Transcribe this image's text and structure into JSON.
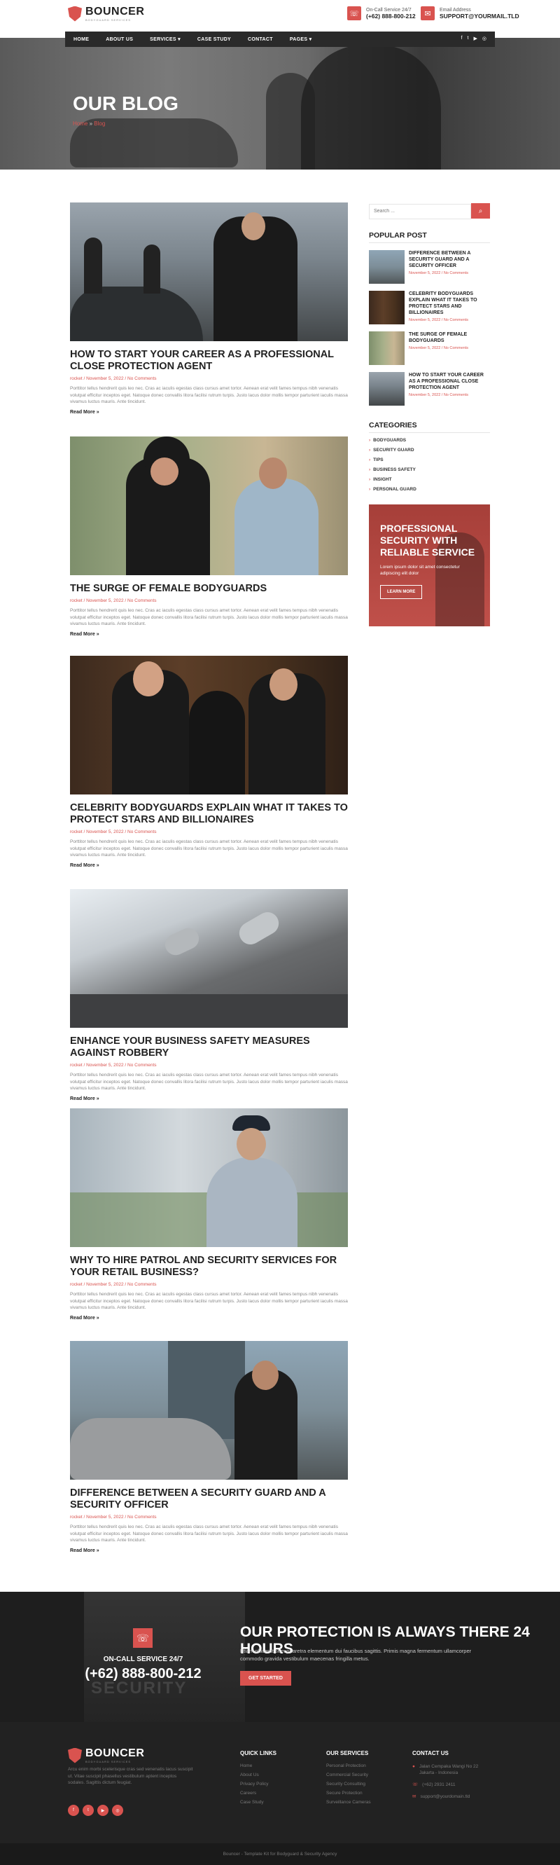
{
  "brand": {
    "name": "BOUNCER",
    "tagline": "BODYGUARD SERVICES"
  },
  "topbar": {
    "call_label": "On-Call Service 24/7",
    "call_value": "(+62) 888-800-212",
    "email_label": "Email Address",
    "email_value": "SUPPORT@YOURMAIL.TLD"
  },
  "nav": {
    "items": [
      "HOME",
      "ABOUT US",
      "SERVICES ▾",
      "CASE STUDY",
      "CONTACT",
      "PAGES ▾"
    ],
    "social": [
      "f",
      "t",
      "▶",
      "◎"
    ]
  },
  "hero": {
    "title": "OUR BLOG",
    "crumb_home": "Home",
    "crumb_sep": "»",
    "crumb_current": "Blog"
  },
  "posts": [
    {
      "title": "HOW TO START YOUR CAREER AS A PROFESSIONAL CLOSE PROTECTION AGENT",
      "meta": "rocket / November 5, 2022 / No Comments"
    },
    {
      "title": "THE SURGE OF FEMALE BODYGUARDS",
      "meta": "rocket / November 5, 2022 / No Comments"
    },
    {
      "title": "CELEBRITY BODYGUARDS EXPLAIN WHAT IT TAKES TO PROTECT STARS AND BILLIONAIRES",
      "meta": "rocket / November 5, 2022 / No Comments"
    },
    {
      "title": "ENHANCE YOUR BUSINESS SAFETY MEASURES AGAINST ROBBERY",
      "meta": "rocket / November 5, 2022 / No Comments"
    },
    {
      "title": "WHY TO HIRE PATROL AND SECURITY SERVICES FOR YOUR RETAIL BUSINESS?",
      "meta": "rocket / November 5, 2022 / No Comments"
    },
    {
      "title": "DIFFERENCE BETWEEN A SECURITY GUARD AND A SECURITY OFFICER",
      "meta": "rocket / November 5, 2022 / No Comments"
    }
  ],
  "post_excerpt": "Porttitor tellus hendrerit quis leo nec. Cras ac iaculis egestas class cursus amet tortor. Aenean erat velit fames tempus nibh venenatis volutpat efficitur inceptos eget. Natoque donec convallis litora facilisi rutrum turpis. Justo lacus dolor mollis tempor parturient iaculis massa vivamus luctus mauris. Ante tincidunt.",
  "read_more": "Read More »",
  "sidebar": {
    "search_placeholder": "Search ...",
    "popular_heading": "POPULAR POST",
    "popular": [
      {
        "title": "DIFFERENCE BETWEEN A SECURITY GUARD AND A SECURITY OFFICER",
        "meta": "November 5, 2022 / No Comments"
      },
      {
        "title": "CELEBRITY BODYGUARDS EXPLAIN WHAT IT TAKES TO PROTECT STARS AND BILLIONAIRES",
        "meta": "November 5, 2022 / No Comments"
      },
      {
        "title": "THE SURGE OF FEMALE BODYGUARDS",
        "meta": "November 5, 2022 / No Comments"
      },
      {
        "title": "HOW TO START YOUR CAREER AS A PROFESSIONAL CLOSE PROTECTION AGENT",
        "meta": "November 5, 2022 / No Comments"
      }
    ],
    "categories_heading": "CATEGORIES",
    "categories": [
      "BODYGUARDS",
      "SECURITY GUARD",
      "TIPS",
      "BUSINESS SAFETY",
      "INSIGHT",
      "PERSONAL GUARD"
    ],
    "promo_title": "PROFESSIONAL SECURITY WITH RELIABLE SERVICE",
    "promo_text": "Lorem ipsum dolor sit amet consectetur adipiscing elit dolor",
    "promo_button": "LEARN MORE"
  },
  "cta": {
    "oncall": "ON-CALL SERVICE 24/7",
    "phone": "(+62) 888-800-212",
    "watermark": "SECURITY",
    "title": "OUR PROTECTION IS ALWAYS THERE 24 HOURS",
    "text": "Etiam placerat sem pharetra elementum dui faucibus sagittis. Primis magna fermentum ullamcorper commodo gravida vestibulum maecenas fringilla metus.",
    "button": "GET STARTED"
  },
  "footer": {
    "desc": "Arcu enim morbi scelerisque cras sed venenatis lacus suscipit ut. Vitae suscipit phasellus vestibulum aptent inceptos sodales. Sagittis dictum feugiat.",
    "social": [
      "f",
      "t",
      "▶",
      "◎"
    ],
    "quick_links_title": "QUICK LINKS",
    "quick_links": [
      "Home",
      "About Us",
      "Privacy Policy",
      "Careers",
      "Case Study"
    ],
    "services_title": "OUR SERVICES",
    "services": [
      "Personal Protection",
      "Commercial Security",
      "Security Consulting",
      "Secure Protection",
      "Surveillance Cameras"
    ],
    "contact_title": "CONTACT US",
    "contact_address": "Jalan Cempaka Wangi No 22 Jakarta - Indonesia",
    "contact_phone": "(+62) 2931 2411",
    "contact_email": "support@yourdomain.tld",
    "copyright": "Bouncer - Template Kit for Bodyguard & Security Agency"
  },
  "colors": {
    "accent": "#d9534f",
    "dark": "#222222"
  }
}
